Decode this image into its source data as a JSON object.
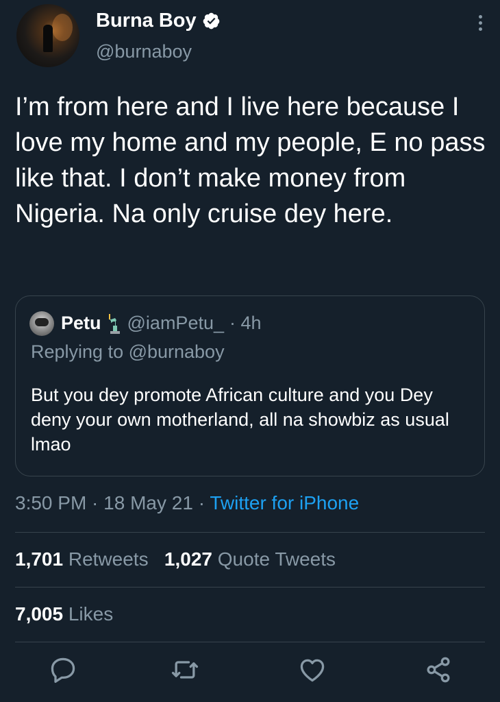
{
  "author": {
    "display_name": "Burna Boy",
    "handle": "@burnaboy",
    "verified": true
  },
  "tweet": {
    "text": "I’m from here and I live here because I love my home and my people, E no pass like that. I don’t make money from Nigeria. Na only cruise dey here."
  },
  "quoted_tweet": {
    "display_name": "Petu",
    "handle": "@iamPetu_",
    "time_ago": "· 4h",
    "replying_to": "Replying to @burnaboy",
    "text": "But you dey promote African culture and you Dey deny your own motherland, all na showbiz as usual lmao"
  },
  "meta": {
    "time": "3:50 PM",
    "separator1": " · ",
    "date": "18 May 21",
    "separator2": " · ",
    "source": "Twitter for iPhone"
  },
  "stats": {
    "retweets_count": "1,701",
    "retweets_label": "Retweets",
    "quotes_count": "1,027",
    "quotes_label": "Quote Tweets",
    "likes_count": "7,005",
    "likes_label": "Likes"
  },
  "icons": {
    "verified": "verified-badge-icon",
    "more": "more-vertical-icon",
    "reply": "reply-icon",
    "retweet": "retweet-icon",
    "like": "heart-icon",
    "share": "share-icon",
    "emoji": "statue-of-liberty-emoji"
  },
  "colors": {
    "background": "#15202b",
    "muted": "#8899a6",
    "accent": "#1da1f2",
    "border": "#38444d"
  }
}
